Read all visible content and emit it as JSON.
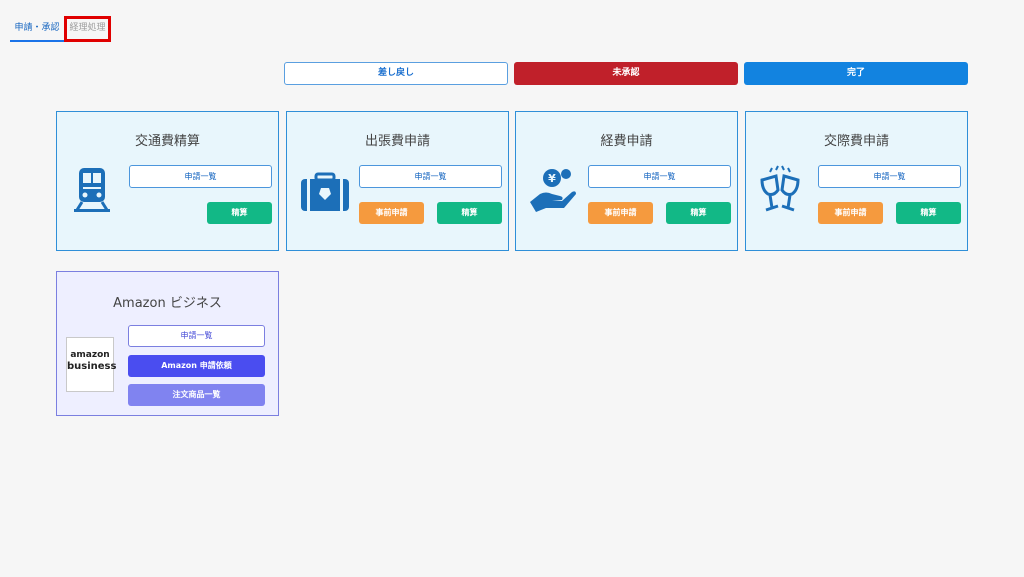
{
  "tabs": [
    {
      "label": "申請・承認",
      "active": true
    },
    {
      "label": "経理処理",
      "active": false
    }
  ],
  "status_buttons": {
    "returned": "差し戻し",
    "pending": "未承認",
    "done": "完了"
  },
  "cards": [
    {
      "title": "交通費精算",
      "icon": "train-icon",
      "list_label": "申請一覧",
      "settle_label": "精算"
    },
    {
      "title": "出張費申請",
      "icon": "briefcase-icon",
      "list_label": "申請一覧",
      "pre_label": "事前申請",
      "settle_label": "精算"
    },
    {
      "title": "経費申請",
      "icon": "hand-coin-icon",
      "list_label": "申請一覧",
      "pre_label": "事前申請",
      "settle_label": "精算"
    },
    {
      "title": "交際費申請",
      "icon": "wine-glasses-icon",
      "list_label": "申請一覧",
      "pre_label": "事前申請",
      "settle_label": "精算"
    }
  ],
  "amazon": {
    "title": "Amazon ビジネス",
    "logo_line1": "amazon",
    "logo_line2": "business",
    "list_label": "申請一覧",
    "request_label": "Amazon 申請依頼",
    "orders_label": "注文商品一覧"
  },
  "colors": {
    "primary": "#1283e0",
    "pending": "#c0202a",
    "pre_apply": "#f59a3e",
    "settle": "#12b886",
    "amazon_accent": "#4a4df0"
  }
}
